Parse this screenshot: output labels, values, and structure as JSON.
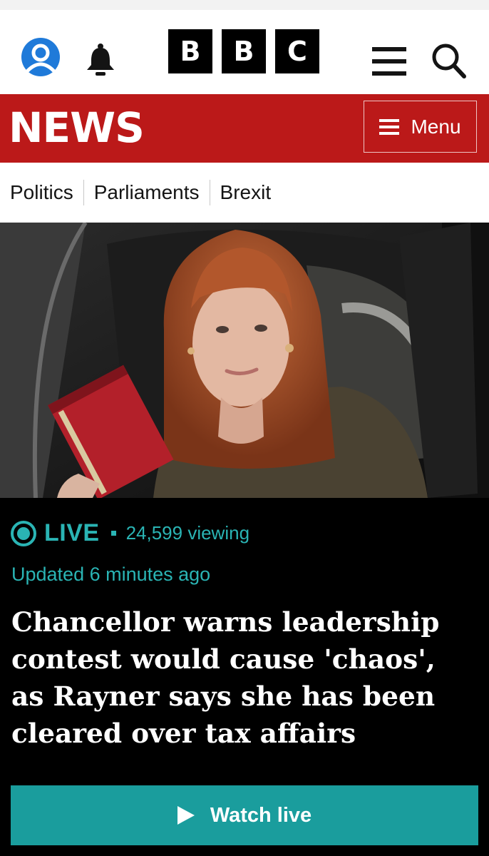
{
  "header": {
    "brand_letters": [
      "B",
      "B",
      "C"
    ],
    "icons": {
      "account": "account-icon",
      "notifications": "bell-icon",
      "menu": "hamburger-icon",
      "search": "search-icon"
    }
  },
  "news_bar": {
    "title": "NEWS",
    "menu_label": "Menu"
  },
  "subnav": {
    "items": [
      "Politics",
      "Parliaments",
      "Brexit"
    ],
    "active": "Politics"
  },
  "story": {
    "live_label": "LIVE",
    "viewing": "24,599 viewing",
    "updated": "Updated 6 minutes ago",
    "headline": "Chancellor warns leadership contest would cause 'chaos', as Rayner says she has been cleared over tax affairs",
    "watch_label": "Watch live"
  },
  "colors": {
    "news_red": "#bb1919",
    "live_teal": "#2ab4b4",
    "watch_button": "#1a9d9d",
    "account_blue": "#1f7ad9"
  }
}
